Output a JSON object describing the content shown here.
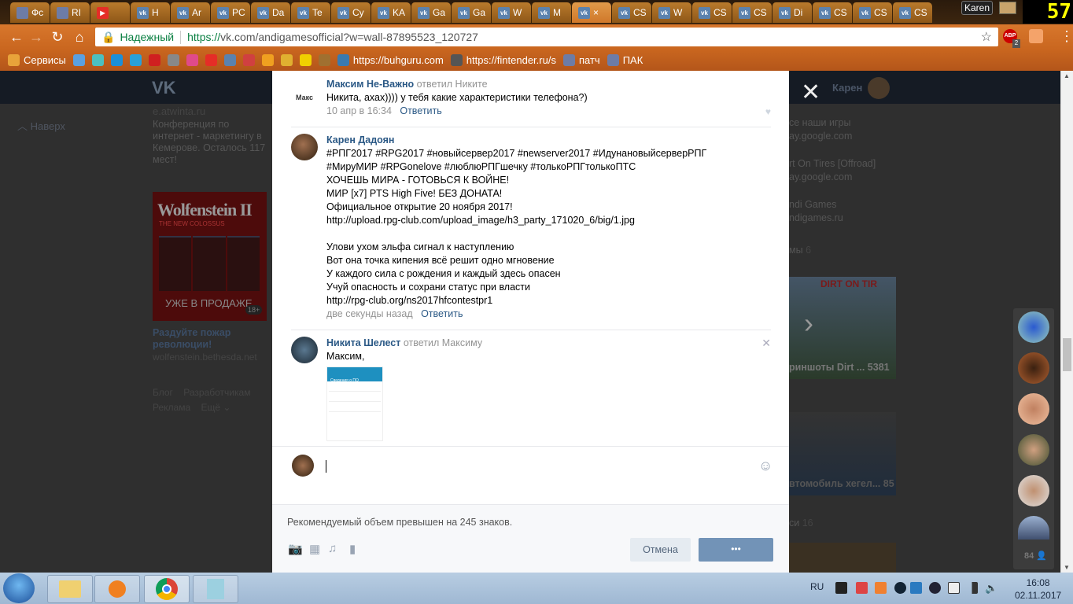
{
  "browser": {
    "tabs": [
      {
        "title": "Фс",
        "icon": "gov"
      },
      {
        "title": "RI",
        "icon": "gov"
      },
      {
        "title": "",
        "icon": "yt"
      },
      {
        "title": "Н",
        "icon": "vk"
      },
      {
        "title": "Ar",
        "icon": "vk"
      },
      {
        "title": "PC",
        "icon": "vk"
      },
      {
        "title": "Da",
        "icon": "vk"
      },
      {
        "title": "Te",
        "icon": "vk"
      },
      {
        "title": "Cy",
        "icon": "vk"
      },
      {
        "title": "KA",
        "icon": "vk"
      },
      {
        "title": "Ga",
        "icon": "vk"
      },
      {
        "title": "Ga",
        "icon": "vk"
      },
      {
        "title": "W",
        "icon": "vk"
      },
      {
        "title": "M",
        "icon": "vk"
      },
      {
        "title": "×",
        "icon": "vk",
        "active": true
      },
      {
        "title": "CS",
        "icon": "vk"
      },
      {
        "title": "W",
        "icon": "vk"
      },
      {
        "title": "CS",
        "icon": "vk"
      },
      {
        "title": "CS",
        "icon": "vk"
      },
      {
        "title": "Di",
        "icon": "vk"
      },
      {
        "title": "CS",
        "icon": "vk"
      },
      {
        "title": "CS",
        "icon": "vk"
      },
      {
        "title": "CS",
        "icon": "vk"
      }
    ],
    "profile_name": "Karen",
    "overlay_counter": "57",
    "secure_label": "Надежный",
    "url_scheme": "https://",
    "url_rest": "vk.com/andigamesofficial?w=wall-87895523_120727",
    "abp_label": "ABP",
    "abp_count": "2",
    "bookmarks": [
      {
        "label": "Сервисы",
        "color": "#e8a33a"
      },
      {
        "label": "",
        "color": "#5aa0e0"
      },
      {
        "label": "",
        "color": "#4cc0c0"
      },
      {
        "label": "",
        "color": "#1b8fd8"
      },
      {
        "label": "",
        "color": "#2aa0d8"
      },
      {
        "label": "",
        "color": "#d02020"
      },
      {
        "label": "",
        "color": "#888888"
      },
      {
        "label": "",
        "color": "#e04a8a"
      },
      {
        "label": "",
        "color": "#e52d27"
      },
      {
        "label": "",
        "color": "#5b82ae"
      },
      {
        "label": "",
        "color": "#d04040"
      },
      {
        "label": "",
        "color": "#f0a020"
      },
      {
        "label": "",
        "color": "#e0b030"
      },
      {
        "label": "",
        "color": "#f0d000"
      },
      {
        "label": "",
        "color": "#a07030"
      },
      {
        "label": "https://buhguru.com",
        "color": "#3a7ab0"
      },
      {
        "label": "https://fintender.ru/s",
        "color": "#555555"
      },
      {
        "label": "патч",
        "color": "#6d7ca6"
      },
      {
        "label": "ПАК",
        "color": "#6d7ca6"
      }
    ]
  },
  "vk": {
    "logo": "VK",
    "back_to_top": "Наверх",
    "ad": {
      "domain": "e.atwinta.ru",
      "text": "Конференция по интернет - маркетингу в Кемерове. Осталось 117 мест!",
      "image_title": "Wolfenstein II",
      "image_subtitle": "THE NEW COLOSSUS",
      "image_caption": "УЖЕ В ПРОДАЖЕ",
      "age": "18+",
      "title": "Раздуйте пожар революции!",
      "link": "wolfenstein.bethesda.net"
    },
    "footer_links": [
      "Блог",
      "Разработчикам",
      "Реклама",
      "Ещё ⌄"
    ],
    "user_name": "Карен",
    "right": {
      "links": [
        {
          "title": "се наши игры",
          "sub": "ay.google.com"
        },
        {
          "title": "rt On Tires [Offroad]",
          "sub": "ay.google.com"
        },
        {
          "title": "ndi Games",
          "sub": "ndigames.ru"
        }
      ],
      "albums_label": "мы",
      "albums_count": "6",
      "album1": "риншоты Dirt ...",
      "album1_count": "5381",
      "album2": "втомобиль хегел...",
      "album2_count": "85",
      "section3": "си",
      "section3_count": "16"
    },
    "friends_count": "84"
  },
  "modal": {
    "comments": [
      {
        "author": "Максим Не-Важно",
        "reply_to": "ответил Никите",
        "avatar_text": "Макс",
        "text": [
          "Никита, ахах)))) у тебя какие характеристики телефона?)"
        ],
        "time": "10 апр в 16:34",
        "reply": "Ответить"
      },
      {
        "author": "Карен Дадоян",
        "reply_to": "",
        "text": [
          "#РПГ2017 #RPG2017 #новыйсервер2017 #newserver2017 #ИдунановыйсерверРПГ",
          "#МируМИР #RPGonelove #люблюРПГшечку #толькоРПГтолькоПТС",
          "ХОЧЕШЬ МИРА - ГОТОВЬСЯ К ВОЙНЕ!",
          "МИР [x7] PTS High Five! БЕЗ ДОНАТА!",
          "Официальное открытие 20 ноября 2017!",
          "http://upload.rpg-club.com/upload_image/h3_party_171020_6/big/1.jpg",
          "",
          "Улови ухом эльфа сигнал к наступлению",
          "Вот она точка кипения всё решит одно мгновение",
          "У каждого сила с рождения и каждый здесь опасен",
          "Учуй опасность и сохрани статус при власти",
          "http://rpg-club.org/ns2017hfcontestpr1"
        ],
        "time": "две секунды назад",
        "reply": "Ответить"
      },
      {
        "author": "Никита Шелест",
        "reply_to": "ответил Максиму",
        "text": [
          "Максим,"
        ],
        "screenshot_title": "Сведения о ПО"
      }
    ],
    "warning": "Рекомендуемый объем превышен на 245 знаков.",
    "cancel": "Отмена",
    "send": "•••"
  },
  "taskbar": {
    "lang": "RU",
    "time": "16:08",
    "date": "02.11.2017"
  }
}
